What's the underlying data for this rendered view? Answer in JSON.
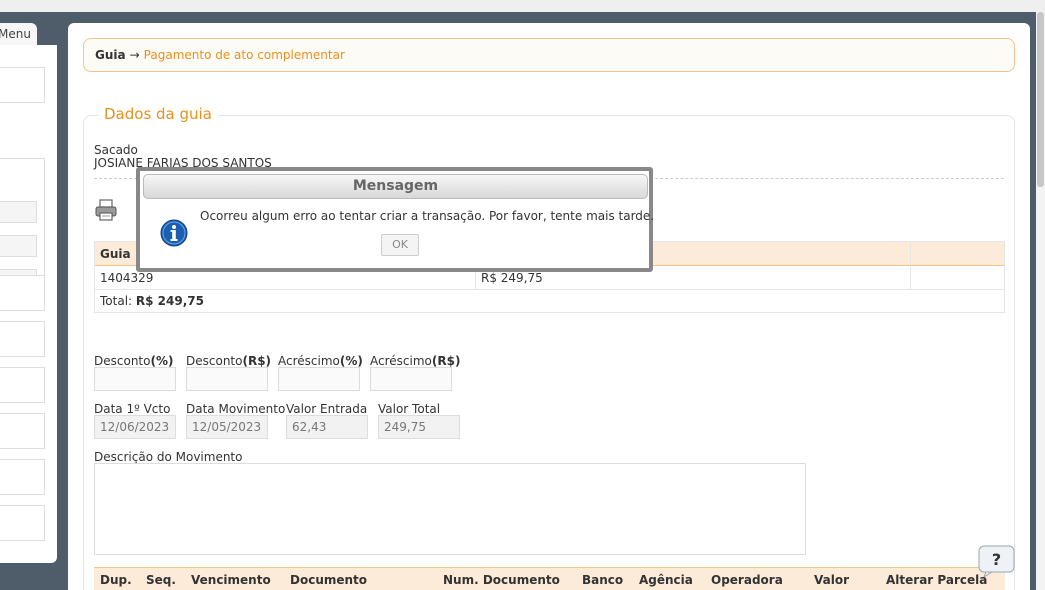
{
  "sidebar": {
    "menu_tab_label": "Menu"
  },
  "breadcrumb": {
    "root": "Guia",
    "arrow": "→",
    "page": "Pagamento de ato complementar"
  },
  "section": {
    "legend": "Dados da guia"
  },
  "sacado": {
    "label": "Sacado",
    "value": "JOSIANE FARIAS DOS SANTOS"
  },
  "guia_table": {
    "header_guia": "Guia",
    "row_guia": "1404329",
    "row_valor": "R$ 249,75",
    "total_label": "Total:",
    "total_value": "R$ 249,75"
  },
  "fields": {
    "desconto_pct": {
      "label": "Desconto",
      "suffix": "(%)"
    },
    "desconto_rs": {
      "label": "Desconto",
      "suffix": "(R$)"
    },
    "acrescimo_pct": {
      "label": "Acréscimo",
      "suffix": "(%)"
    },
    "acrescimo_rs": {
      "label": "Acréscimo",
      "suffix": "(R$)"
    },
    "data_vcto": {
      "label": "Data 1º Vcto",
      "value": "12/06/2023"
    },
    "data_mov": {
      "label": "Data Movimento",
      "value": "12/05/2023"
    },
    "valor_entrada": {
      "label": "Valor Entrada",
      "value": "62,43"
    },
    "valor_total": {
      "label": "Valor Total",
      "value": "249,75"
    },
    "descricao": {
      "label": "Descrição do Movimento"
    }
  },
  "dup_table": {
    "columns": [
      "Dup.",
      "Seq.",
      "Vencimento",
      "Documento",
      "Num. Documento",
      "Banco",
      "Agência",
      "Operadora",
      "Valor",
      "Alterar Parcela"
    ]
  },
  "modal": {
    "title": "Mensagem",
    "message": "Ocorreu algum erro ao tentar criar a transação. Por favor, tente mais tarde.",
    "ok_label": "OK",
    "icon": "info-icon"
  },
  "help": {
    "label": "?"
  },
  "colors": {
    "accent": "#e8901d",
    "header_bg": "#fcebd8",
    "page_bg": "#4f5d6b"
  }
}
